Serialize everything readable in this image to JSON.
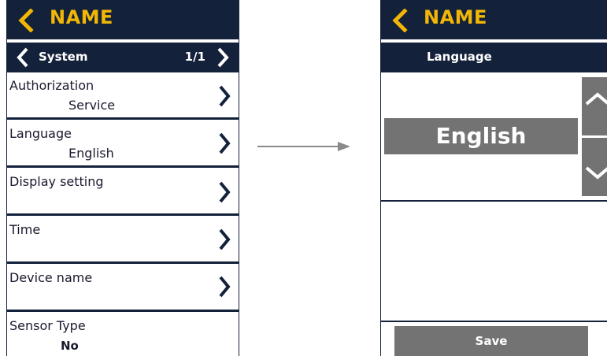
{
  "left_screen": {
    "title": "NAME",
    "sub_header": {
      "label": "System",
      "page": "1/1"
    },
    "rows": [
      {
        "label": "Authorization",
        "value": "Service"
      },
      {
        "label": "Language",
        "value": "English"
      },
      {
        "label": "Display setting",
        "value": ""
      },
      {
        "label": "Time",
        "value": ""
      },
      {
        "label": "Device name",
        "value": ""
      },
      {
        "label": "Sensor Type",
        "value": "No"
      }
    ]
  },
  "right_screen": {
    "title": "NAME",
    "sub_header": {
      "label": "Language"
    },
    "selected_language": "English",
    "save_label": "Save"
  },
  "icons": {
    "back": "chevron-left-icon",
    "next": "chevron-right-icon",
    "scroll_up": "chevron-up-icon",
    "scroll_down": "chevron-down-icon",
    "transition": "arrow-right-icon"
  },
  "colors": {
    "header_bg": "#14213a",
    "title_text": "#f2b705",
    "button_bg": "#737373",
    "text": "#1a1a2e"
  }
}
